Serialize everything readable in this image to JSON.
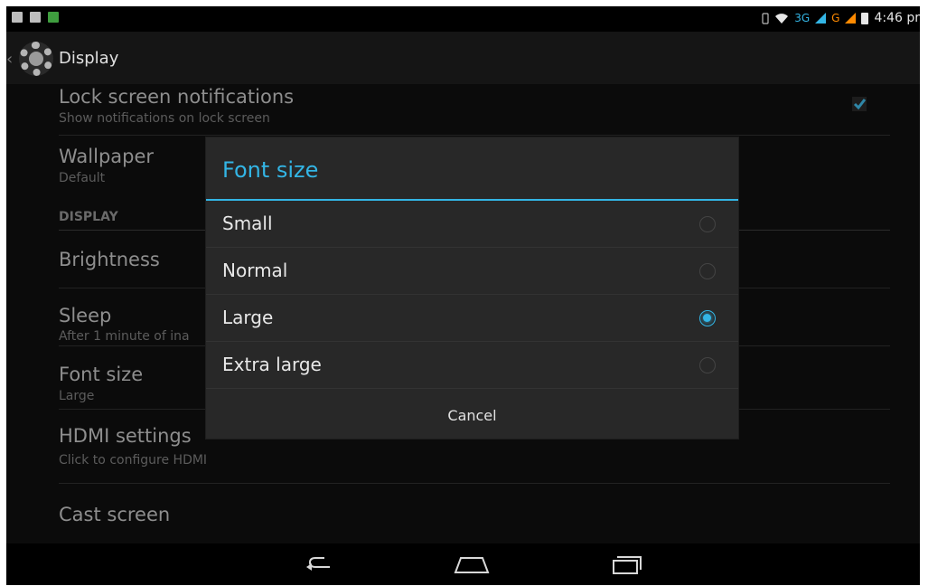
{
  "statusbar": {
    "network_label_1": "3G",
    "network_label_2": "G",
    "time": "4:46 pr"
  },
  "actionbar": {
    "title": "Display"
  },
  "settings": {
    "lock_screen": {
      "title": "Lock screen notifications",
      "subtitle": "Show notifications on lock screen",
      "checked": true
    },
    "wallpaper": {
      "title": "Wallpaper",
      "subtitle": "Default"
    },
    "section_display": "DISPLAY",
    "brightness": {
      "title": "Brightness"
    },
    "sleep": {
      "title": "Sleep",
      "subtitle": "After 1 minute of ina"
    },
    "font_size": {
      "title": "Font size",
      "subtitle": "Large"
    },
    "hdmi": {
      "title": "HDMI settings",
      "subtitle": "Click to configure HDMI"
    },
    "cast": {
      "title": "Cast screen"
    }
  },
  "dialog": {
    "title": "Font size",
    "options": [
      {
        "label": "Small",
        "selected": false
      },
      {
        "label": "Normal",
        "selected": false
      },
      {
        "label": "Large",
        "selected": true
      },
      {
        "label": "Extra large",
        "selected": false
      }
    ],
    "cancel_label": "Cancel"
  },
  "colors": {
    "accent": "#33b5e5",
    "background": "#0b0b0b",
    "dialog": "#282828"
  },
  "icons": {
    "settings": "gear-icon",
    "back": "back-icon",
    "home": "home-icon",
    "recents": "recents-icon",
    "wifi": "wifi-icon",
    "battery": "battery-icon"
  }
}
